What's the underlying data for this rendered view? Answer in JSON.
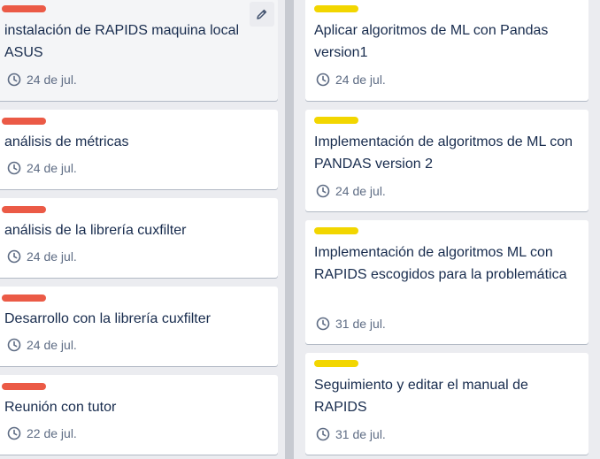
{
  "colors": {
    "label_red": "#eb5a46",
    "label_yellow": "#f2d600",
    "text": "#172b4d",
    "meta": "#5e6c84"
  },
  "lists": {
    "left": {
      "cards": [
        {
          "title": "instalación de RAPIDS maquina local ASUS",
          "date": "24 de jul.",
          "label_color": "red"
        },
        {
          "title": "análisis de métricas",
          "date": "24 de jul.",
          "label_color": "red"
        },
        {
          "title": "análisis de la librería cuxfilter",
          "date": "24 de jul.",
          "label_color": "red"
        },
        {
          "title": "Desarrollo con la librería cuxfilter",
          "date": "24 de jul.",
          "label_color": "red"
        },
        {
          "title": "Reunión con tutor",
          "date": "22 de jul.",
          "label_color": "red"
        }
      ]
    },
    "right": {
      "cards": [
        {
          "title": "Aplicar algoritmos de ML con Pandas version1",
          "date": "24 de jul.",
          "label_color": "yellow"
        },
        {
          "title": "Implementación de algoritmos de ML con PANDAS version 2",
          "date": "24 de jul.",
          "label_color": "yellow"
        },
        {
          "title": "Implementación de algoritmos ML con RAPIDS escogidos para la problemática",
          "date": "31 de jul.",
          "label_color": "yellow"
        },
        {
          "title": "Seguimiento y editar el manual de RAPIDS",
          "date": "31 de jul.",
          "label_color": "yellow"
        }
      ]
    }
  },
  "icons": {
    "edit": "pencil-icon",
    "due_date": "clock-icon"
  }
}
